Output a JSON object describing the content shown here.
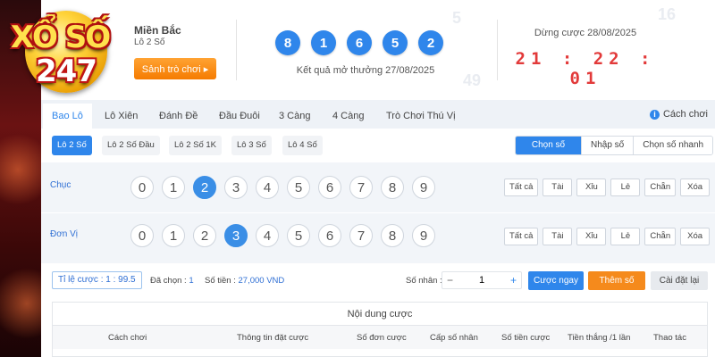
{
  "brand": {
    "line1": "XỔ SỐ",
    "line2": "247"
  },
  "header": {
    "region": "Miền Bắc",
    "game": "Lô 2 Số",
    "lobby_button": "Sảnh trò chơi ▸",
    "result_numbers": [
      "8",
      "1",
      "6",
      "5",
      "2"
    ],
    "result_label": "Kết quả mở thưởng 27/08/2025",
    "deadline_label": "Dừng cược 28/08/2025",
    "countdown": "21:22:01"
  },
  "tabs": {
    "items": [
      "Bao Lô",
      "Lô Xiên",
      "Đánh Đề",
      "Đầu Đuôi",
      "3 Càng",
      "4 Càng",
      "Trò Chơi Thú Vị"
    ],
    "active": 0,
    "howto": "Cách chơi",
    "howto_icon": "info-icon"
  },
  "subtabs": {
    "items": [
      "Lô 2 Số",
      "Lô 2 Số Đầu",
      "Lô 2 Số 1K",
      "Lô 3 Số",
      "Lô 4 Số"
    ],
    "active": 0
  },
  "input_modes": {
    "items": [
      "Chọn số",
      "Nhập số",
      "Chọn số nhanh"
    ],
    "active": 0
  },
  "rows": [
    {
      "label": "Chục",
      "digits": [
        "0",
        "1",
        "2",
        "3",
        "4",
        "5",
        "6",
        "7",
        "8",
        "9"
      ],
      "selected": "2"
    },
    {
      "label": "Đơn Vị",
      "digits": [
        "0",
        "1",
        "2",
        "3",
        "4",
        "5",
        "6",
        "7",
        "8",
        "9"
      ],
      "selected": "3"
    }
  ],
  "quick_buttons": [
    "Tất cả",
    "Tài",
    "Xỉu",
    "Lẻ",
    "Chẵn",
    "Xóa"
  ],
  "bet_bar": {
    "ratio": "Tỉ lệ cược : 1 : 99.5",
    "chosen_label": "Đã chọn :",
    "chosen_value": "1",
    "amount_label": "Số tiền :",
    "amount_value": "27,000 VND",
    "multiplier_label": "Số nhân :",
    "multiplier_value": "1",
    "bet_now": "Cược ngay",
    "add_number": "Thêm số",
    "reset": "Cài đặt lại"
  },
  "bet_table": {
    "title": "Nội dung cược",
    "columns": [
      "Cách chơi",
      "Thông tin đặt cược",
      "Số đơn cược",
      "Cấp số nhân",
      "Số tiền cược",
      "Tiền thắng /1 lần",
      "Thao tác"
    ]
  },
  "colors": {
    "primary": "#2f86eb",
    "orange": "#f58a1c",
    "timer": "#e23a3a"
  }
}
